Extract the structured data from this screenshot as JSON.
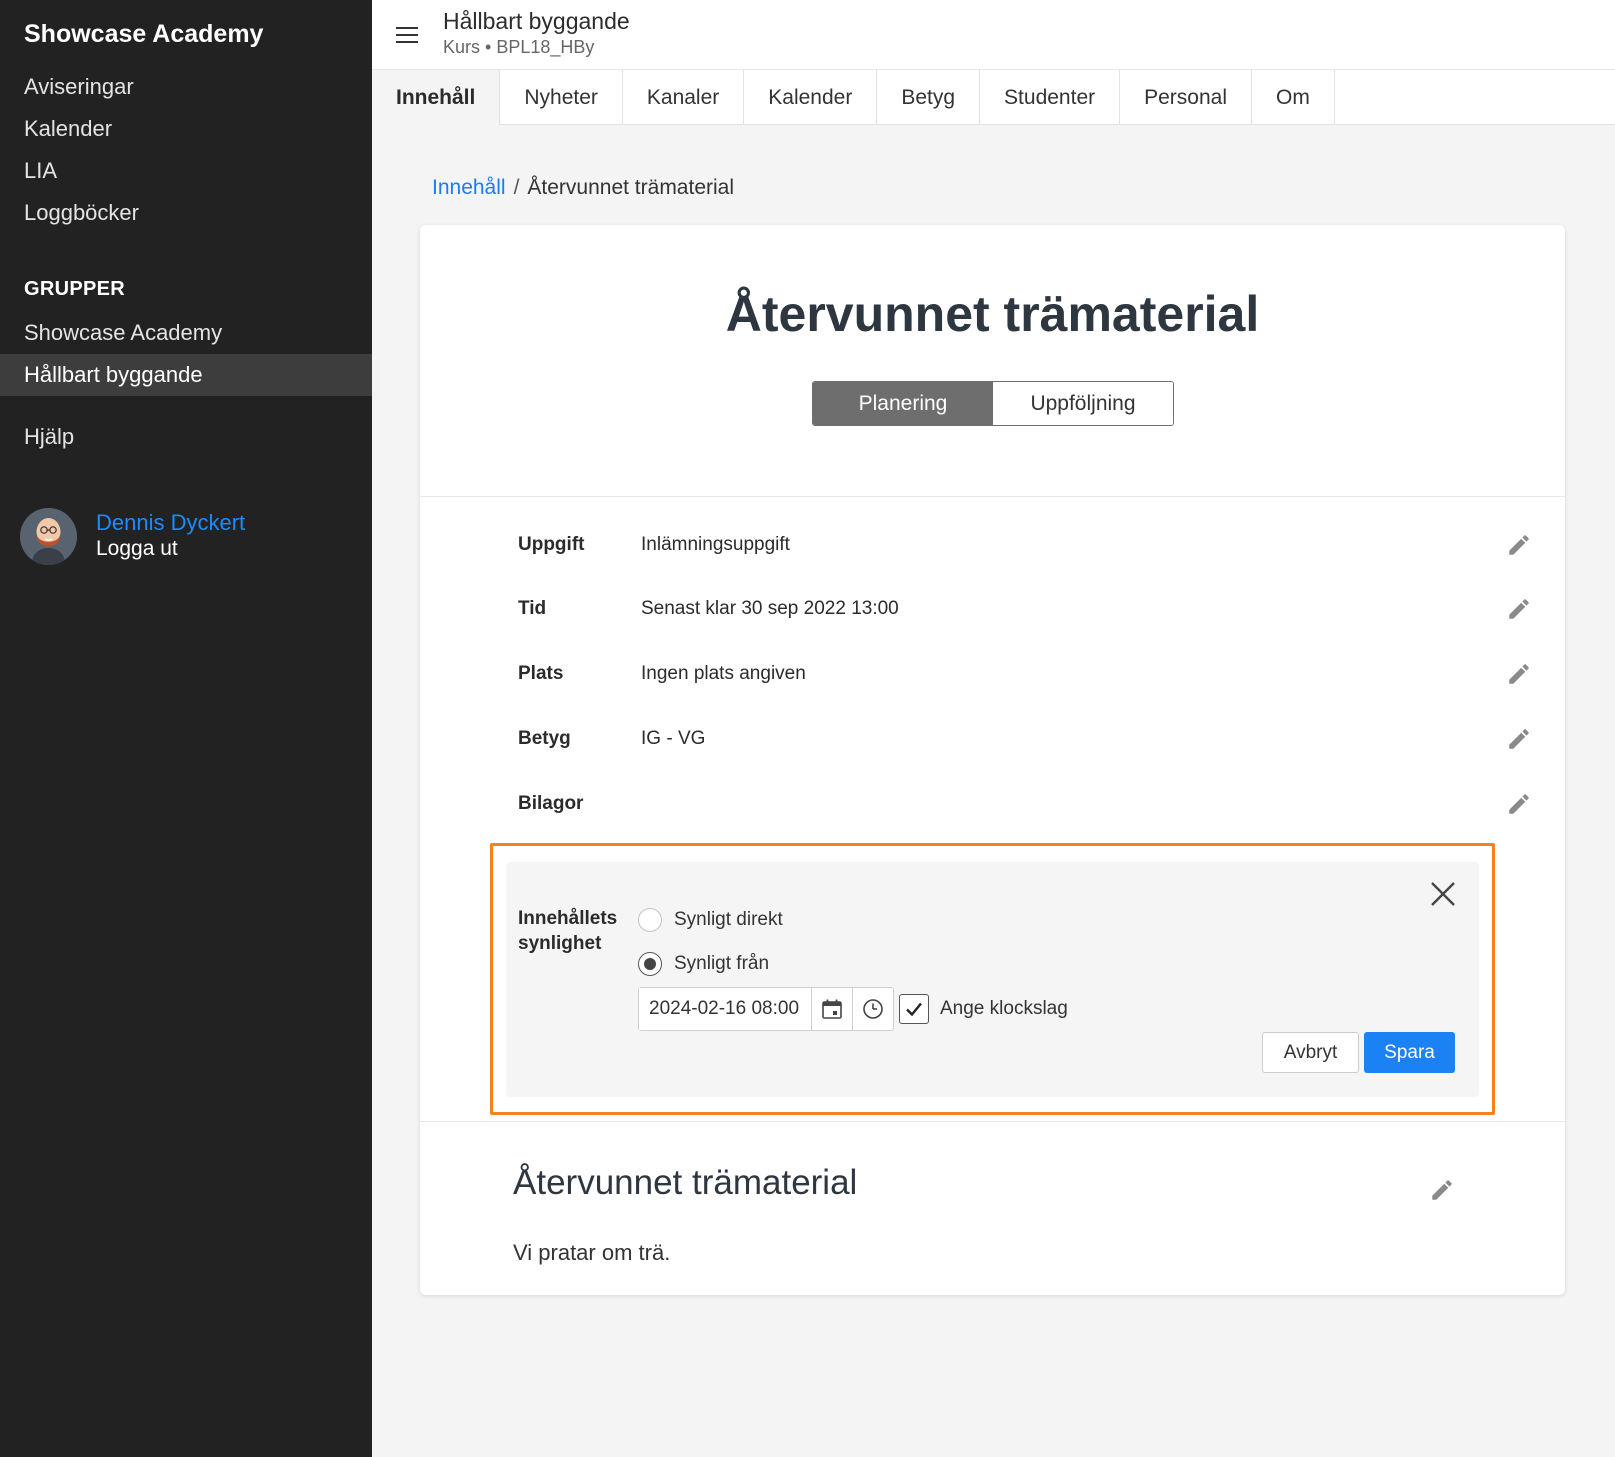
{
  "sidebar": {
    "brand": "Showcase Academy",
    "nav": [
      "Aviseringar",
      "Kalender",
      "LIA",
      "Loggböcker"
    ],
    "groups_title": "GRUPPER",
    "groups": [
      "Showcase Academy",
      "Hållbart byggande"
    ],
    "help": "Hjälp",
    "user": {
      "name": "Dennis Dyckert",
      "logout": "Logga ut"
    }
  },
  "header": {
    "title": "Hållbart byggande",
    "subtitle": "Kurs • BPL18_HBy"
  },
  "tabs": [
    "Innehåll",
    "Nyheter",
    "Kanaler",
    "Kalender",
    "Betyg",
    "Studenter",
    "Personal",
    "Om"
  ],
  "breadcrumb": {
    "link": "Innehåll",
    "separator": "/",
    "current": "Återvunnet trämaterial"
  },
  "content": {
    "title": "Återvunnet trämaterial",
    "segments": {
      "planning": "Planering",
      "followup": "Uppföljning"
    },
    "rows": [
      {
        "label": "Uppgift",
        "value": "Inlämningsuppgift"
      },
      {
        "label": "Tid",
        "value": "Senast klar 30 sep 2022 13:00"
      },
      {
        "label": "Plats",
        "value": "Ingen plats angiven"
      },
      {
        "label": "Betyg",
        "value": "IG - VG"
      },
      {
        "label": "Bilagor",
        "value": ""
      }
    ],
    "visibility": {
      "label_line1": "Innehållets",
      "label_line2": "synlighet",
      "option_direct": "Synligt direkt",
      "option_from": "Synligt från",
      "datetime": "2024-02-16 08:00",
      "checkbox_label": "Ange klockslag",
      "cancel": "Avbryt",
      "save": "Spara"
    },
    "section_heading": "Återvunnet trämaterial",
    "section_text": "Vi pratar om trä."
  },
  "colors": {
    "accent": "#1a82f5",
    "highlight": "#f28321",
    "sidebar": "#222222"
  }
}
